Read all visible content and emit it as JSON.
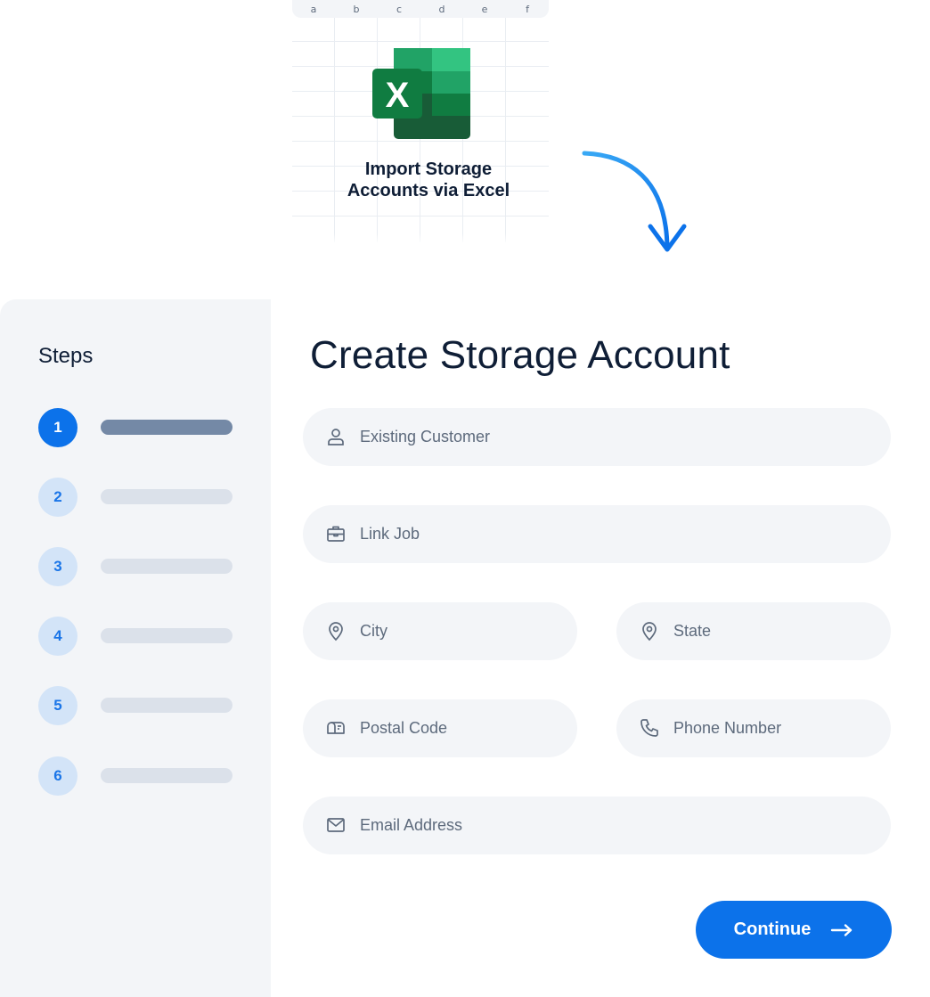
{
  "excel_card": {
    "columns": [
      "a",
      "b",
      "c",
      "d",
      "e",
      "f"
    ],
    "title_line1": "Import Storage",
    "title_line2": "Accounts via Excel",
    "logo_letter": "X",
    "brand_colors": [
      "#185c37",
      "#107c41",
      "#21a366",
      "#33c481"
    ]
  },
  "sidebar": {
    "title": "Steps",
    "steps": [
      {
        "number": "1",
        "active": true
      },
      {
        "number": "2",
        "active": false
      },
      {
        "number": "3",
        "active": false
      },
      {
        "number": "4",
        "active": false
      },
      {
        "number": "5",
        "active": false
      },
      {
        "number": "6",
        "active": false
      }
    ]
  },
  "form": {
    "title": "Create Storage Account",
    "fields": {
      "existing_customer": {
        "placeholder": "Existing Customer",
        "icon": "user-icon"
      },
      "link_job": {
        "placeholder": "Link Job",
        "icon": "briefcase-icon"
      },
      "city": {
        "placeholder": "City",
        "icon": "map-pin-icon"
      },
      "state": {
        "placeholder": "State",
        "icon": "map-pin-icon"
      },
      "postal_code": {
        "placeholder": "Postal Code",
        "icon": "mailbox-icon"
      },
      "phone_number": {
        "placeholder": "Phone Number",
        "icon": "phone-icon"
      },
      "email_address": {
        "placeholder": "Email Address",
        "icon": "envelope-icon"
      }
    },
    "continue_label": "Continue"
  },
  "colors": {
    "primary": "#0c72ea",
    "step_inactive_bg": "#d3e4f8",
    "field_bg": "#f3f5f8",
    "text_dark": "#0f1e36",
    "placeholder": "#5d6a7c"
  }
}
